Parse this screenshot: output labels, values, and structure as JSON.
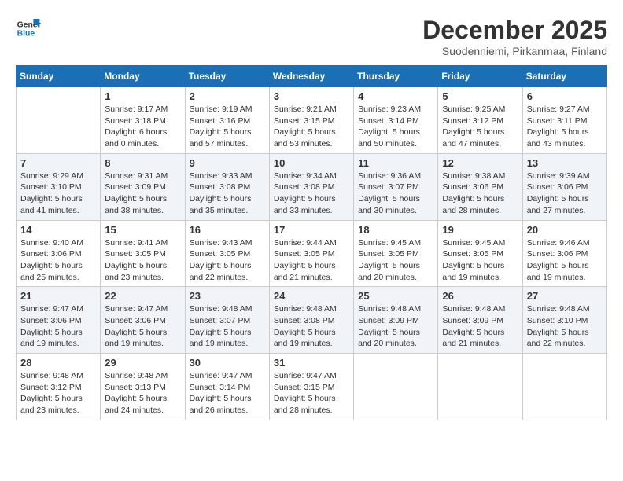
{
  "header": {
    "logo_line1": "General",
    "logo_line2": "Blue",
    "title": "December 2025",
    "subtitle": "Suodenniemi, Pirkanmaa, Finland"
  },
  "weekdays": [
    "Sunday",
    "Monday",
    "Tuesday",
    "Wednesday",
    "Thursday",
    "Friday",
    "Saturday"
  ],
  "weeks": [
    [
      {
        "day": "",
        "info": ""
      },
      {
        "day": "1",
        "info": "Sunrise: 9:17 AM\nSunset: 3:18 PM\nDaylight: 6 hours\nand 0 minutes."
      },
      {
        "day": "2",
        "info": "Sunrise: 9:19 AM\nSunset: 3:16 PM\nDaylight: 5 hours\nand 57 minutes."
      },
      {
        "day": "3",
        "info": "Sunrise: 9:21 AM\nSunset: 3:15 PM\nDaylight: 5 hours\nand 53 minutes."
      },
      {
        "day": "4",
        "info": "Sunrise: 9:23 AM\nSunset: 3:14 PM\nDaylight: 5 hours\nand 50 minutes."
      },
      {
        "day": "5",
        "info": "Sunrise: 9:25 AM\nSunset: 3:12 PM\nDaylight: 5 hours\nand 47 minutes."
      },
      {
        "day": "6",
        "info": "Sunrise: 9:27 AM\nSunset: 3:11 PM\nDaylight: 5 hours\nand 43 minutes."
      }
    ],
    [
      {
        "day": "7",
        "info": "Sunrise: 9:29 AM\nSunset: 3:10 PM\nDaylight: 5 hours\nand 41 minutes."
      },
      {
        "day": "8",
        "info": "Sunrise: 9:31 AM\nSunset: 3:09 PM\nDaylight: 5 hours\nand 38 minutes."
      },
      {
        "day": "9",
        "info": "Sunrise: 9:33 AM\nSunset: 3:08 PM\nDaylight: 5 hours\nand 35 minutes."
      },
      {
        "day": "10",
        "info": "Sunrise: 9:34 AM\nSunset: 3:08 PM\nDaylight: 5 hours\nand 33 minutes."
      },
      {
        "day": "11",
        "info": "Sunrise: 9:36 AM\nSunset: 3:07 PM\nDaylight: 5 hours\nand 30 minutes."
      },
      {
        "day": "12",
        "info": "Sunrise: 9:38 AM\nSunset: 3:06 PM\nDaylight: 5 hours\nand 28 minutes."
      },
      {
        "day": "13",
        "info": "Sunrise: 9:39 AM\nSunset: 3:06 PM\nDaylight: 5 hours\nand 27 minutes."
      }
    ],
    [
      {
        "day": "14",
        "info": "Sunrise: 9:40 AM\nSunset: 3:06 PM\nDaylight: 5 hours\nand 25 minutes."
      },
      {
        "day": "15",
        "info": "Sunrise: 9:41 AM\nSunset: 3:05 PM\nDaylight: 5 hours\nand 23 minutes."
      },
      {
        "day": "16",
        "info": "Sunrise: 9:43 AM\nSunset: 3:05 PM\nDaylight: 5 hours\nand 22 minutes."
      },
      {
        "day": "17",
        "info": "Sunrise: 9:44 AM\nSunset: 3:05 PM\nDaylight: 5 hours\nand 21 minutes."
      },
      {
        "day": "18",
        "info": "Sunrise: 9:45 AM\nSunset: 3:05 PM\nDaylight: 5 hours\nand 20 minutes."
      },
      {
        "day": "19",
        "info": "Sunrise: 9:45 AM\nSunset: 3:05 PM\nDaylight: 5 hours\nand 19 minutes."
      },
      {
        "day": "20",
        "info": "Sunrise: 9:46 AM\nSunset: 3:06 PM\nDaylight: 5 hours\nand 19 minutes."
      }
    ],
    [
      {
        "day": "21",
        "info": "Sunrise: 9:47 AM\nSunset: 3:06 PM\nDaylight: 5 hours\nand 19 minutes."
      },
      {
        "day": "22",
        "info": "Sunrise: 9:47 AM\nSunset: 3:06 PM\nDaylight: 5 hours\nand 19 minutes."
      },
      {
        "day": "23",
        "info": "Sunrise: 9:48 AM\nSunset: 3:07 PM\nDaylight: 5 hours\nand 19 minutes."
      },
      {
        "day": "24",
        "info": "Sunrise: 9:48 AM\nSunset: 3:08 PM\nDaylight: 5 hours\nand 19 minutes."
      },
      {
        "day": "25",
        "info": "Sunrise: 9:48 AM\nSunset: 3:09 PM\nDaylight: 5 hours\nand 20 minutes."
      },
      {
        "day": "26",
        "info": "Sunrise: 9:48 AM\nSunset: 3:09 PM\nDaylight: 5 hours\nand 21 minutes."
      },
      {
        "day": "27",
        "info": "Sunrise: 9:48 AM\nSunset: 3:10 PM\nDaylight: 5 hours\nand 22 minutes."
      }
    ],
    [
      {
        "day": "28",
        "info": "Sunrise: 9:48 AM\nSunset: 3:12 PM\nDaylight: 5 hours\nand 23 minutes."
      },
      {
        "day": "29",
        "info": "Sunrise: 9:48 AM\nSunset: 3:13 PM\nDaylight: 5 hours\nand 24 minutes."
      },
      {
        "day": "30",
        "info": "Sunrise: 9:47 AM\nSunset: 3:14 PM\nDaylight: 5 hours\nand 26 minutes."
      },
      {
        "day": "31",
        "info": "Sunrise: 9:47 AM\nSunset: 3:15 PM\nDaylight: 5 hours\nand 28 minutes."
      },
      {
        "day": "",
        "info": ""
      },
      {
        "day": "",
        "info": ""
      },
      {
        "day": "",
        "info": ""
      }
    ]
  ]
}
